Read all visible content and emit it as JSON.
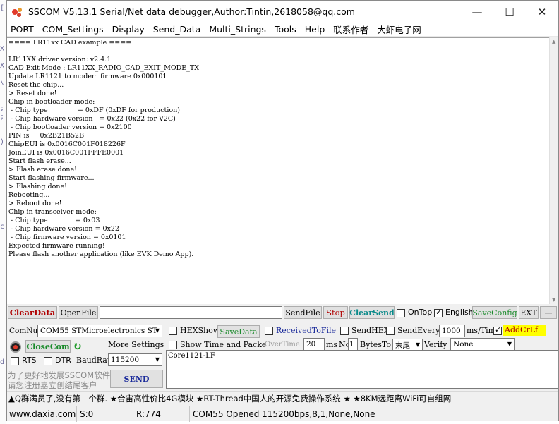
{
  "window": {
    "title": "SSCOM V5.13.1 Serial/Net data debugger,Author:Tintin,2618058@qq.com",
    "minimize": "—",
    "maximize": "☐",
    "close": "✕"
  },
  "menu": [
    "PORT",
    "COM_Settings",
    "Display",
    "Send_Data",
    "Multi_Strings",
    "Tools",
    "Help",
    "联系作者",
    "大虾电子网"
  ],
  "output": {
    "lines": [
      "==== LR11xx CAD example ====",
      "",
      "LR11XX driver version: v2.4.1",
      "CAD Exit Mode : LR11XX_RADIO_CAD_EXIT_MODE_TX",
      "Update LR1121 to modem firmware 0x000101",
      "Reset the chip...",
      "> Reset done!",
      "Chip in bootloader mode:",
      " - Chip type              = 0xDF (0xDF for production)",
      " - Chip hardware version   = 0x22 (0x22 for V2C)",
      " - Chip bootloader version = 0x2100",
      "PIN is     0x2B21B52B",
      "ChipEUI is 0x0016C001F018226F",
      "JoinEUI is 0x0016C001FFFE0001",
      "Start flash erase...",
      "> Flash erase done!",
      "Start flashing firmware...",
      "> Flashing done!",
      "Rebooting...",
      "> Reboot done!",
      "Chip in transceiver mode:",
      " - Chip type             = 0x03",
      " - Chip hardware version = 0x22",
      " - Chip firmware version = 0x0101",
      "Expected firmware running!",
      "Please flash another application (like EVK Demo App)."
    ]
  },
  "controls": {
    "clear_data": "ClearData",
    "open_file": "OpenFile",
    "file_path": "",
    "send_file": "SendFile",
    "stop": "Stop",
    "clear_send": "ClearSend",
    "ontop": "OnTop",
    "ontop_checked": false,
    "english": "English",
    "english_checked": true,
    "save_config": "SaveConfig",
    "ext": "EXT",
    "dash": "—",
    "comnum_label": "ComNum",
    "comnum_value": "COM55 STMicroelectronics ST",
    "hexshow": "HEXShow",
    "save_data": "SaveData",
    "received_to_file": "ReceivedToFile",
    "send_hex": "SendHEX",
    "send_every": "SendEvery:",
    "send_every_value": "1000",
    "send_every_unit": "ms/Tim",
    "add_crlf": "AddCrLf",
    "add_crlf_checked": true,
    "close_com": "CloseCom",
    "more_settings": "More Settings",
    "show_time": "Show Time and Packe",
    "overtime_label": "OverTime:",
    "overtime_value": "20",
    "overtime_unit": "ms",
    "no_label": "No",
    "no_value": "1",
    "bytes_to": "BytesTo",
    "end_value": "末尾",
    "verify_label": "Verify",
    "verify_value": "None",
    "rts": "RTS",
    "dtr": "DTR",
    "baudrate_label": "BaudRate",
    "baudrate_value": "115200",
    "send": "SEND",
    "send_text": "Core1121-LF",
    "promo_line1": "为了更好地发展SSCOM软件",
    "promo_line2": "请您注册嘉立创结尾客户"
  },
  "marquee": "▲Q群满员了,没有第二个群. ★合宙高性价比4G模块 ★RT-Thread中国人的开源免费操作系统 ★ ★8KM远距离WiFi可自组网",
  "status": {
    "url": "www.daxia.com",
    "s": "S:0",
    "r": "R:774",
    "port": "COM55 Opened  115200bps,8,1,None,None"
  },
  "colors": {
    "clear_data_text": "#b00000",
    "clear_send_text": "#0a8a8a",
    "addcrlf_bg": "#ffff00"
  }
}
